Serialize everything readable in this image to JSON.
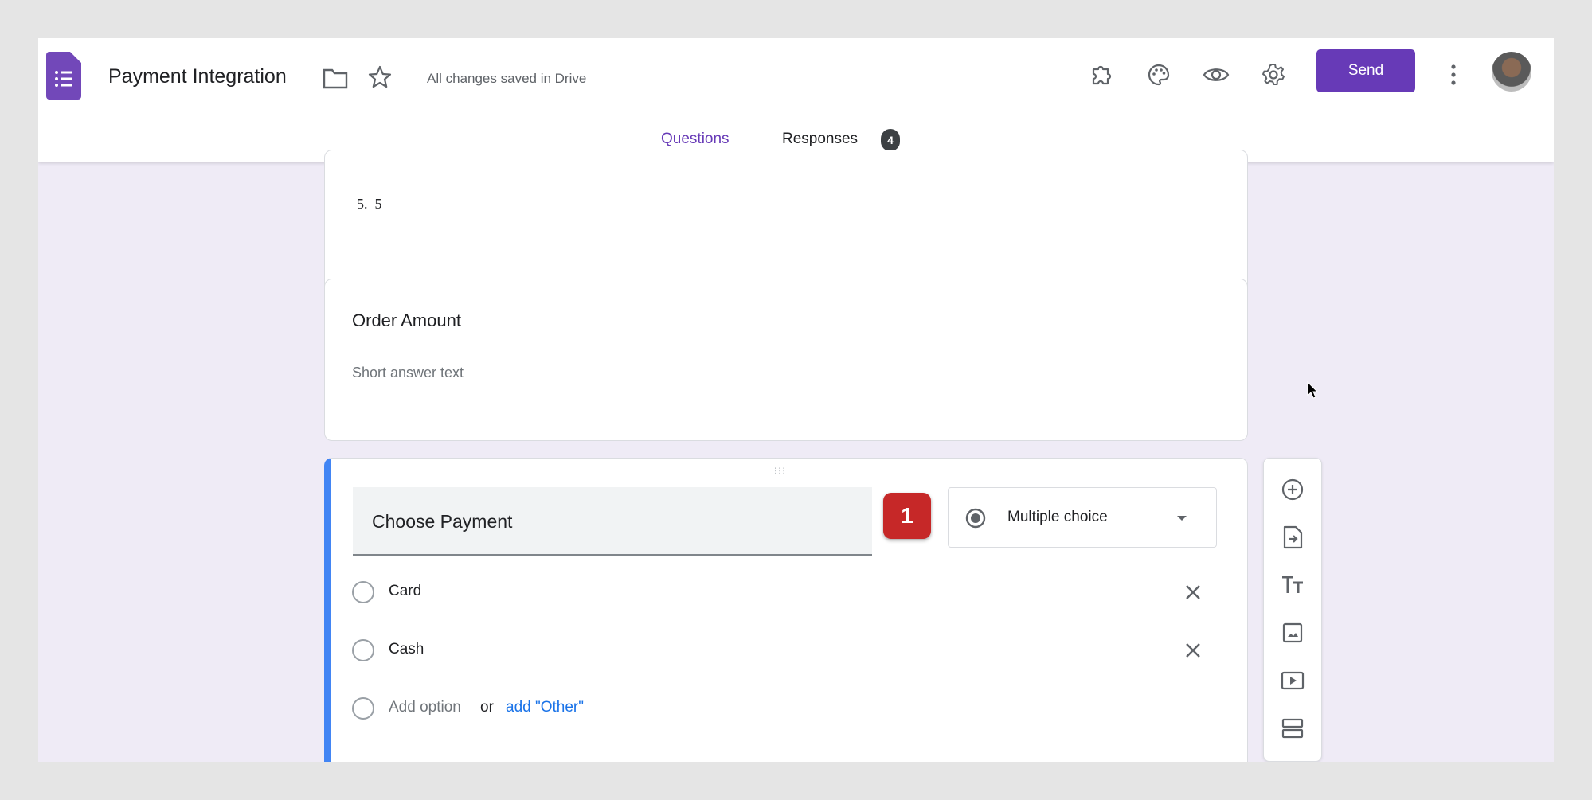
{
  "header": {
    "title": "Payment Integration",
    "save_status": "All changes saved in Drive",
    "send_label": "Send",
    "icons": [
      "forms-logo-icon",
      "folder-icon",
      "star-icon",
      "addons-icon",
      "palette-icon",
      "eye-icon",
      "gear-icon",
      "more-vert-icon",
      "avatar"
    ]
  },
  "tabs": {
    "questions": "Questions",
    "responses": "Responses",
    "responses_count": "4"
  },
  "questions": [
    {
      "number": "5.",
      "value": "5"
    },
    {
      "title": "Order Amount",
      "placeholder": "Short answer text"
    },
    {
      "title": "Choose Payment",
      "type": "Multiple choice",
      "options": [
        "Card",
        "Cash"
      ],
      "add_option": "Add option",
      "or": "or",
      "add_other": "add \"Other\""
    }
  ],
  "annotation": {
    "step": "1"
  },
  "colors": {
    "accent": "#673ab7",
    "background": "#efebf6",
    "active_border": "#4285f4",
    "step_badge": "#c62828",
    "link": "#1a73e8"
  }
}
